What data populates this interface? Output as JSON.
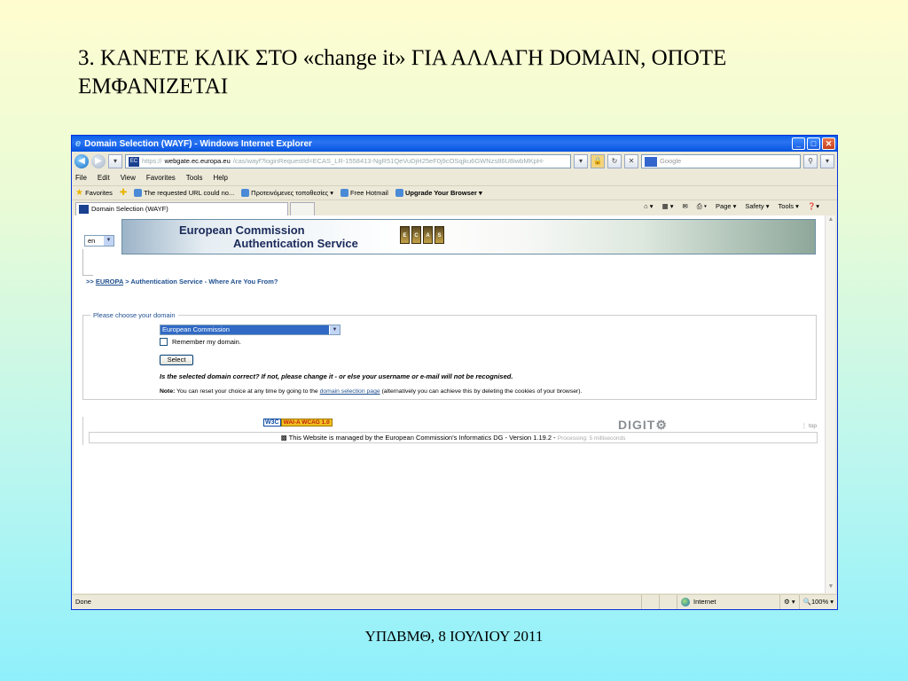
{
  "slide": {
    "title": "3. ΚΑΝΕΤΕ ΚΛΙΚ ΣΤΟ «change it» ΓΙΑ ΑΛΛΑΓΗ DOMAIN, ΟΠΟΤΕ ΕΜΦΑΝΙΖΕΤΑΙ",
    "footer": "ΥΠΔΒΜΘ, 8 ΙΟΥΛΙΟΥ 2011"
  },
  "window": {
    "title": "Domain Selection (WAYF) - Windows Internet Explorer",
    "controls": {
      "minimize": "_",
      "maximize": "□",
      "close": "✕"
    }
  },
  "address": {
    "scheme": "https://",
    "host": "webgate.ec.europa.eu",
    "path": "/cas/wayf?loginRequestId=ECAS_LR-1558413-NgR51QeVuDjH25eF0j9cOSqjku6GWNzs86U8iwbMKpH-",
    "search_placeholder": "Google"
  },
  "menu": [
    "File",
    "Edit",
    "View",
    "Favorites",
    "Tools",
    "Help"
  ],
  "favorites_bar": {
    "favorites_label": "Favorites",
    "items": [
      {
        "label": "The requested URL could no...",
        "bold": false
      },
      {
        "label": "Προτεινόμενες τοποθεσίες ▾",
        "bold": false
      },
      {
        "label": "Free Hotmail",
        "bold": false
      },
      {
        "label": "Upgrade Your Browser ▾",
        "bold": true
      }
    ]
  },
  "tab": {
    "label": "Domain Selection (WAYF)"
  },
  "command_bar": [
    "Page ▾",
    "Safety ▾",
    "Tools ▾"
  ],
  "page": {
    "language": "en",
    "banner_line1": "European Commission",
    "banner_line2": "Authentication Service",
    "ecas_letters": [
      "E",
      "C",
      "A",
      "S"
    ],
    "breadcrumb": {
      "prefix": ">> ",
      "link": "EUROPA",
      "rest": " >  Authentication Service - Where Are You From?"
    },
    "domain_legend": "Please choose your domain",
    "domain_selected": "European Commission",
    "remember_label": "Remember my domain.",
    "select_button": "Select",
    "question": "Is the selected domain correct? If not, please change it - or else your username or e-mail will not be recognised.",
    "note_label": "Note:",
    "note_text": " You can reset your choice at any time by going to the ",
    "note_link": "domain selection page",
    "note_tail": " (alternatively you can achieve this by deleting the cookies of your browser).",
    "w3c_label": "W3C",
    "wai_label": "WAI-A WCAG 1.0",
    "digit_label": "DIGIT",
    "top_link": "top",
    "footer_text": "This Website is managed by the European Commission's Informatics DG - Version 1.19.2 -",
    "footer_processing": "Processing: 5 milliseconds"
  },
  "status": {
    "left": "Done",
    "zone": "Internet",
    "zoom": "100%"
  }
}
